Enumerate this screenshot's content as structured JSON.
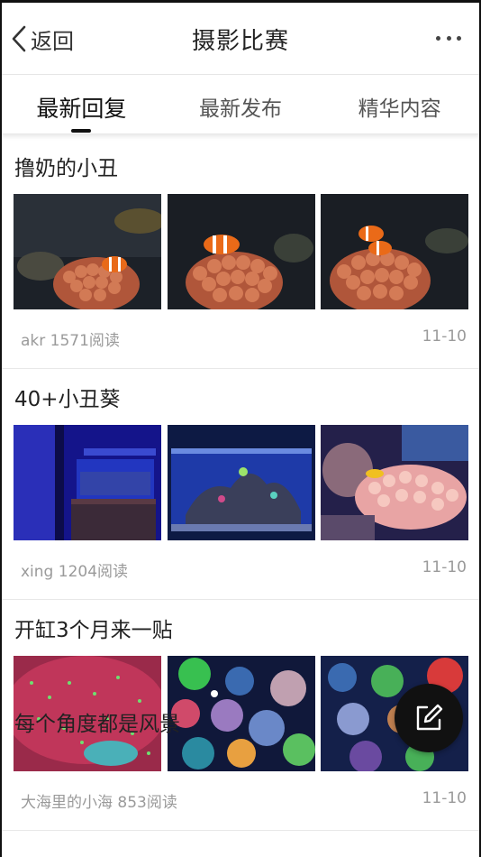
{
  "header": {
    "back_label": "返回",
    "title": "摄影比赛"
  },
  "tabs": [
    {
      "label": "最新回复",
      "active": true
    },
    {
      "label": "最新发布",
      "active": false
    },
    {
      "label": "精华内容",
      "active": false
    }
  ],
  "posts": [
    {
      "title": "撸奶的小丑",
      "author": "akr",
      "reads": "1571阅读",
      "date": "11-10",
      "images": [
        "clownfish-anemone-photo",
        "clownfish-anemone-photo",
        "clownfish-anemone-photo"
      ]
    },
    {
      "title": "40+小丑葵",
      "author": "xing",
      "reads": "1204阅读",
      "date": "11-10",
      "images": [
        "aquarium-tank-photo",
        "aquarium-tank-photo",
        "anemone-closeup-photo"
      ]
    },
    {
      "title": "开缸3个月来一贴",
      "author": "大海里的小海",
      "reads": "853阅读",
      "date": "11-10",
      "images": [
        "coral-closeup-photo",
        "coral-reef-photo",
        "coral-reef-photo"
      ]
    }
  ],
  "partial_post_title": "每个角度都是风景",
  "colors": {
    "accent": "#111111",
    "muted_text": "#9a9a9a",
    "divider": "#e8e8e8"
  },
  "icons": {
    "back": "chevron-left-icon",
    "more": "more-dots-icon",
    "fab": "compose-icon"
  }
}
